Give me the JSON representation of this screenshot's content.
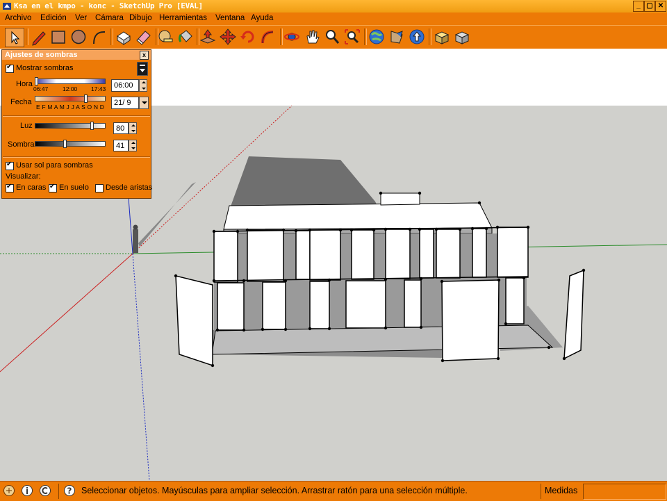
{
  "window": {
    "title": "Ksa en el kmpo - konc - SketchUp Pro [EVAL]",
    "controls": [
      "_",
      "▢",
      "✕"
    ]
  },
  "menu": [
    {
      "label": "Archivo"
    },
    {
      "label": "Edición"
    },
    {
      "label": "Ver"
    },
    {
      "label": "Cámara"
    },
    {
      "label": "Dibujo"
    },
    {
      "label": "Herramientas"
    },
    {
      "label": "Ventana"
    },
    {
      "label": "Ayuda"
    }
  ],
  "toolbar": {
    "tools": [
      "select",
      "pencil",
      "rectangle",
      "circle",
      "arc",
      "make-component",
      "eraser",
      "tape-measure",
      "paint-bucket",
      "push-pull",
      "move",
      "rotate",
      "follow-me",
      "orbit",
      "pan",
      "zoom",
      "zoom-extents",
      "get-models",
      "share-component",
      "share-model",
      "warehouse-upload",
      "warehouse-download"
    ],
    "active_tool": "select"
  },
  "shadow_panel": {
    "title": "Ajustes de sombras",
    "close": "x",
    "show_shadows_label": "Mostrar sombras",
    "show_shadows": true,
    "time_label": "Hora",
    "time_ticks": [
      "06:47",
      "12:00",
      "17:43"
    ],
    "time_value": "06:00",
    "date_label": "Fecha",
    "date_ticks": "E F M A M J J A S O N D",
    "date_value": "21/ 9",
    "light_label": "Luz",
    "light_value": "80",
    "shadow_label": "Sombra",
    "shadow_value": "41",
    "use_sun_label": "Usar sol para sombras",
    "use_sun": true,
    "display_label": "Visualizar:",
    "on_faces_label": "En caras",
    "on_faces": true,
    "on_ground_label": "En suelo",
    "on_ground": true,
    "from_edges_label": "Desde aristas",
    "from_edges": false
  },
  "status_bar": {
    "message": "Seleccionar objetos. Mayúsculas para ampliar selección. Arrastrar ratón para una selección múltiple.",
    "measure_label": "Medidas",
    "measure_value": ""
  },
  "colors": {
    "chrome": "#ed7a06",
    "sky": "#ffffff",
    "ground": "#d0d0cc"
  }
}
